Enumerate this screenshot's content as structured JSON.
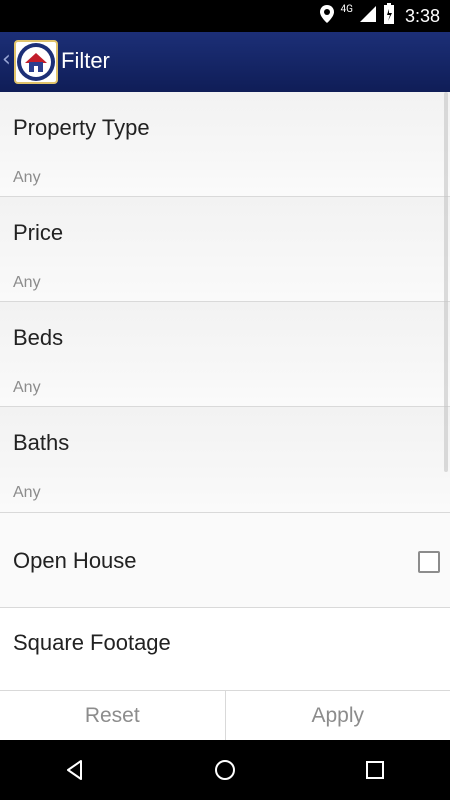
{
  "status_bar": {
    "time": "3:38",
    "network": "4G",
    "icons": [
      "location-icon",
      "signal-icon",
      "battery-icon"
    ]
  },
  "action_bar": {
    "title": "Filter",
    "logo": "home-logo",
    "back_icon": "chevron-left-icon"
  },
  "filters": [
    {
      "label": "Property Type",
      "value": "Any"
    },
    {
      "label": "Price",
      "value": "Any"
    },
    {
      "label": "Beds",
      "value": "Any"
    },
    {
      "label": "Baths",
      "value": "Any"
    },
    {
      "label": "Open House",
      "checked": false
    },
    {
      "label": "Square Footage"
    }
  ],
  "buttons": {
    "reset": "Reset",
    "apply": "Apply"
  },
  "nav": [
    "back-icon",
    "home-icon",
    "recents-icon"
  ]
}
